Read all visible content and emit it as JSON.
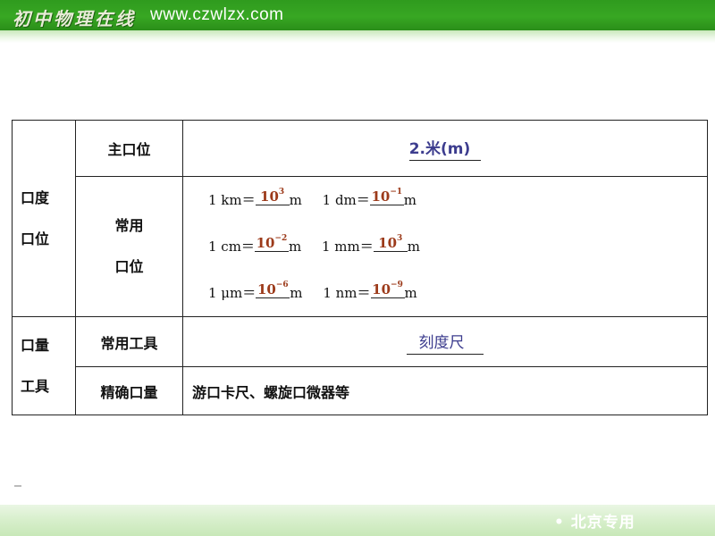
{
  "header": {
    "logo_cn": "初中物理在线",
    "url": "www.czwlzx.com"
  },
  "table": {
    "row_length": {
      "label_lines": [
        "口度",
        "口位"
      ],
      "main_unit": {
        "label": "主口位",
        "answer": "2.米(m)"
      },
      "common_units": {
        "label_lines": [
          "常用",
          "口位"
        ],
        "lines": [
          [
            {
              "prefix": "1 km＝",
              "mantissa": "10",
              "exp": "3",
              "suffix": "m"
            },
            {
              "prefix": "1 dm＝",
              "mantissa": "10",
              "exp": "−1",
              "suffix": "m"
            }
          ],
          [
            {
              "prefix": "1 cm＝",
              "mantissa": "10",
              "exp": "−2",
              "suffix": "m"
            },
            {
              "prefix": "1 mm＝",
              "mantissa": "10",
              "exp": "3",
              "suffix": "m"
            }
          ],
          [
            {
              "prefix": "1 μm＝",
              "mantissa": "10",
              "exp": "−6",
              "suffix": "m"
            },
            {
              "prefix": "1 nm＝",
              "mantissa": "10",
              "exp": "−9",
              "suffix": "m"
            }
          ]
        ]
      }
    },
    "row_tools": {
      "label_lines": [
        "口量",
        "工具"
      ],
      "common_tools": {
        "label": "常用工具",
        "answer": "刻度尺"
      },
      "precise": {
        "label": "精确口量",
        "value": "游口卡尺、螺旋口微器等"
      }
    }
  },
  "footer": {
    "text": "• 北京专用"
  }
}
